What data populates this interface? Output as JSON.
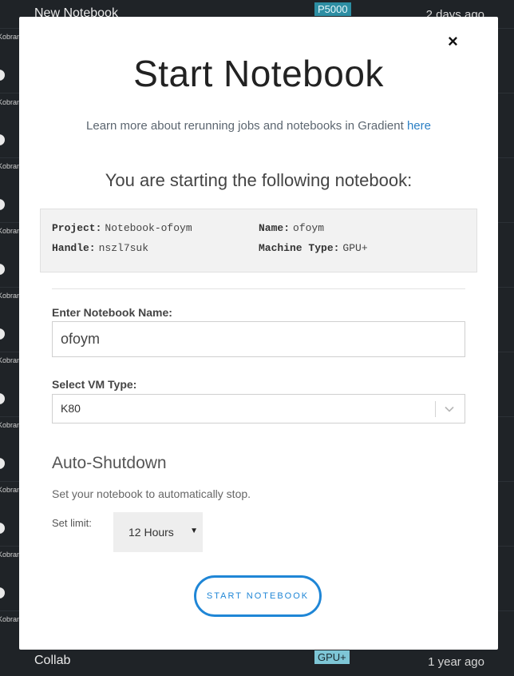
{
  "background_list": [
    {
      "title": "New Notebook",
      "badge": "P5000",
      "time": "2 days ago",
      "user": "Kobran"
    },
    {
      "user": "Kobran"
    },
    {
      "user": "Kobran"
    },
    {
      "user": "Kobran"
    },
    {
      "user": "Kobran"
    },
    {
      "user": "Kobran"
    },
    {
      "user": "Kobran"
    },
    {
      "user": "Kobran"
    },
    {
      "user": "Kobran"
    },
    {
      "user": "Kobran"
    },
    {
      "title": "Collab",
      "badge": "GPU+",
      "time": "1 year ago"
    }
  ],
  "modal": {
    "close_label": "×",
    "title": "Start Notebook",
    "learn_more_text": "Learn more about rerunning jobs and notebooks in Gradient ",
    "learn_more_link": "here",
    "subtitle": "You are starting the following notebook:",
    "info": {
      "project_key": "Project:",
      "project_value": "Notebook-ofoym",
      "name_key": "Name:",
      "name_value": "ofoym",
      "handle_key": "Handle:",
      "handle_value": "nszl7suk",
      "machine_key": "Machine Type:",
      "machine_value": "GPU+"
    },
    "name_field": {
      "label": "Enter Notebook Name:",
      "value": "ofoym"
    },
    "vm_field": {
      "label": "Select VM Type:",
      "value": "K80"
    },
    "auto_shutdown": {
      "title": "Auto-Shutdown",
      "description": "Set your notebook to automatically stop.",
      "limit_label": "Set limit:",
      "limit_value": "12 Hours"
    },
    "start_button_label": "START NOTEBOOK"
  },
  "colors": {
    "accent": "#1f86d6",
    "link": "#2a7fc4",
    "backdrop": "#1f2327"
  }
}
